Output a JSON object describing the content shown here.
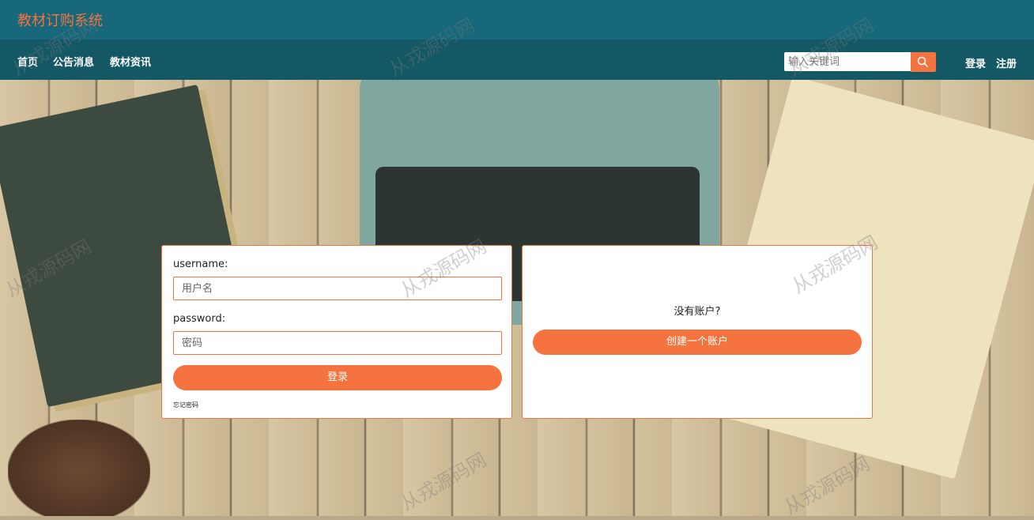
{
  "header": {
    "site_title": "教材订购系统"
  },
  "nav": {
    "items": [
      {
        "label": "首页"
      },
      {
        "label": "公告消息"
      },
      {
        "label": "教材资讯"
      }
    ],
    "search": {
      "placeholder": "输入关键词"
    },
    "auth": {
      "login_label": "登录",
      "register_label": "注册"
    }
  },
  "login_form": {
    "username_label": "username:",
    "username_placeholder": "用户名",
    "password_label": "password:",
    "password_placeholder": "密码",
    "submit_label": "登录",
    "forgot_label": "忘记密码"
  },
  "register_panel": {
    "prompt": "没有账户?",
    "create_label": "创建一个账户"
  },
  "watermark_text": "从戎源码网",
  "colors": {
    "accent": "#f5733f",
    "topbar": "#16687a",
    "navbar": "#145866"
  }
}
